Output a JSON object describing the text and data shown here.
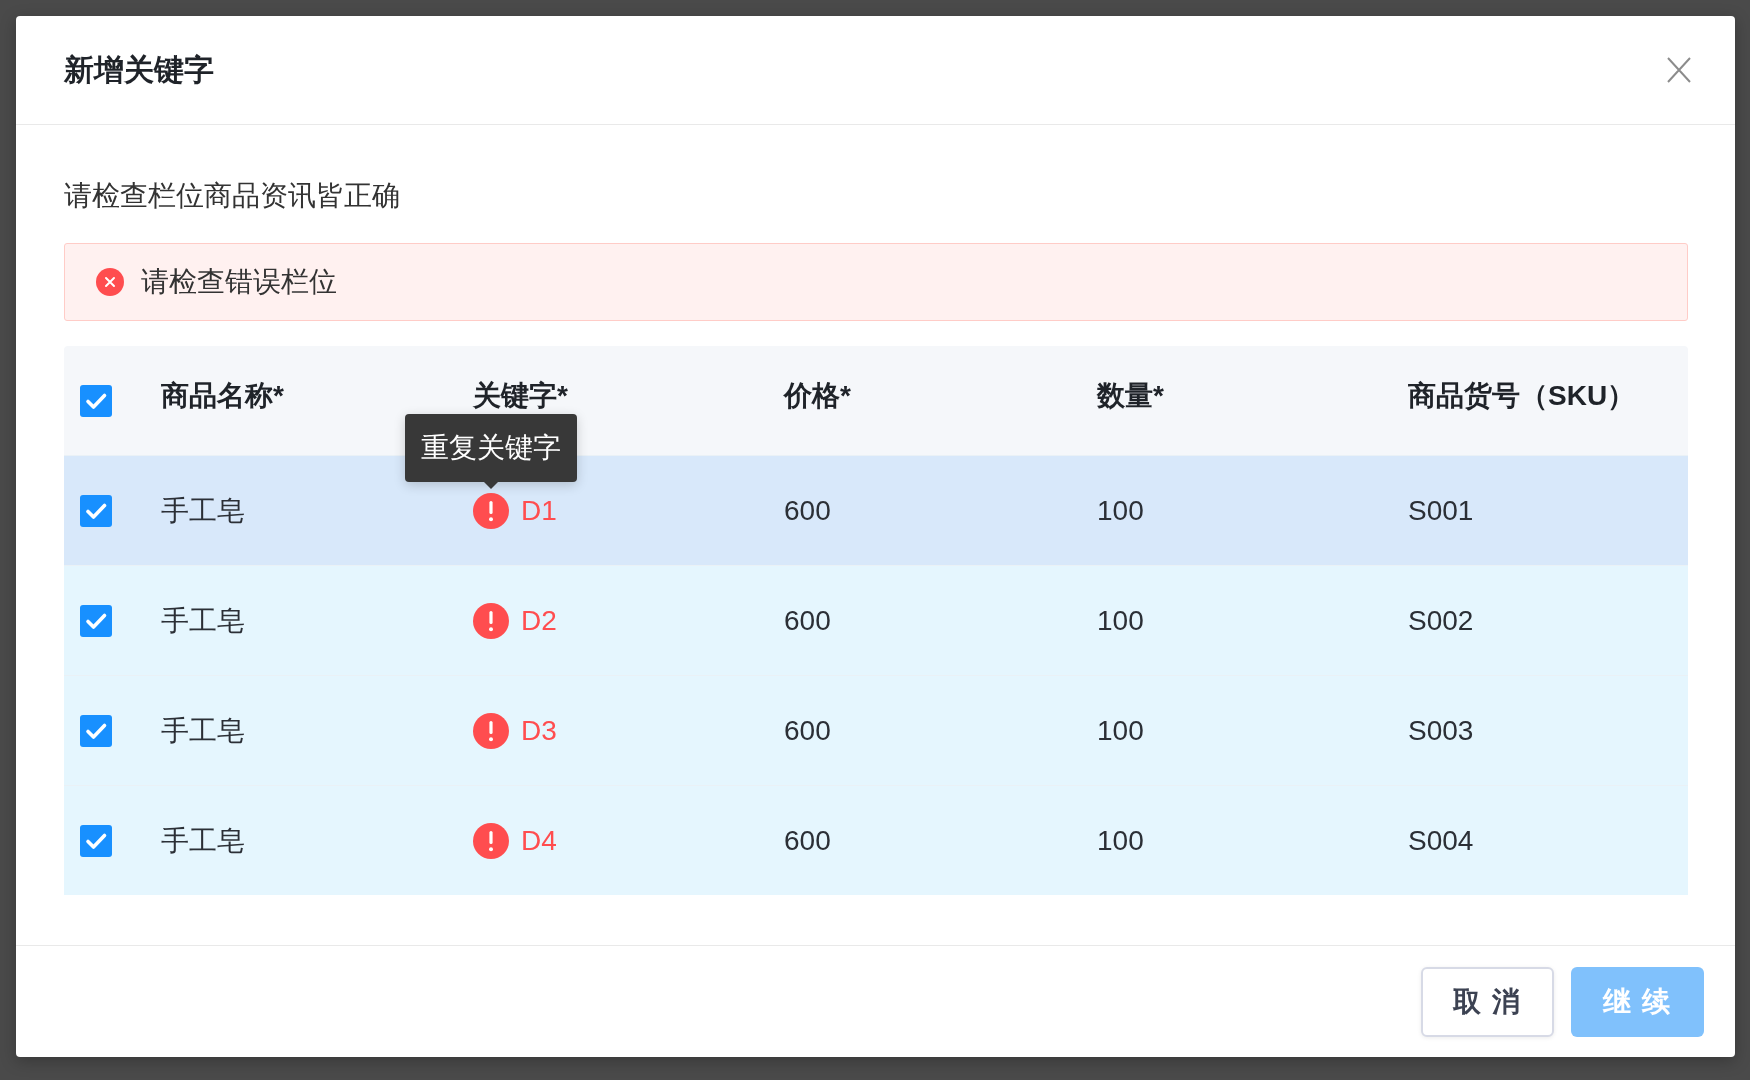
{
  "dialog": {
    "title": "新增关键字",
    "instruction": "请检查栏位商品资讯皆正确",
    "alert": {
      "kind": "error",
      "message": "请检查错误栏位"
    },
    "table": {
      "select_all_checked": true,
      "columns": [
        "商品名称*",
        "关键字*",
        "价格*",
        "数量*",
        "商品货号（SKU）"
      ],
      "rows": [
        {
          "checked": true,
          "hovered": true,
          "product_name": "手工皂",
          "keyword": "D1",
          "keyword_error": true,
          "keyword_tooltip": "重复关键字",
          "price": "600",
          "quantity": "100",
          "sku": "S001"
        },
        {
          "checked": true,
          "hovered": false,
          "product_name": "手工皂",
          "keyword": "D2",
          "keyword_error": true,
          "price": "600",
          "quantity": "100",
          "sku": "S002"
        },
        {
          "checked": true,
          "hovered": false,
          "product_name": "手工皂",
          "keyword": "D3",
          "keyword_error": true,
          "price": "600",
          "quantity": "100",
          "sku": "S003"
        },
        {
          "checked": true,
          "hovered": false,
          "product_name": "手工皂",
          "keyword": "D4",
          "keyword_error": true,
          "price": "600",
          "quantity": "100",
          "sku": "S004"
        }
      ]
    },
    "buttons": [
      {
        "label": "取 消",
        "kind": "default",
        "disabled": false
      },
      {
        "label": "继 续",
        "kind": "primary",
        "disabled": true
      }
    ]
  }
}
